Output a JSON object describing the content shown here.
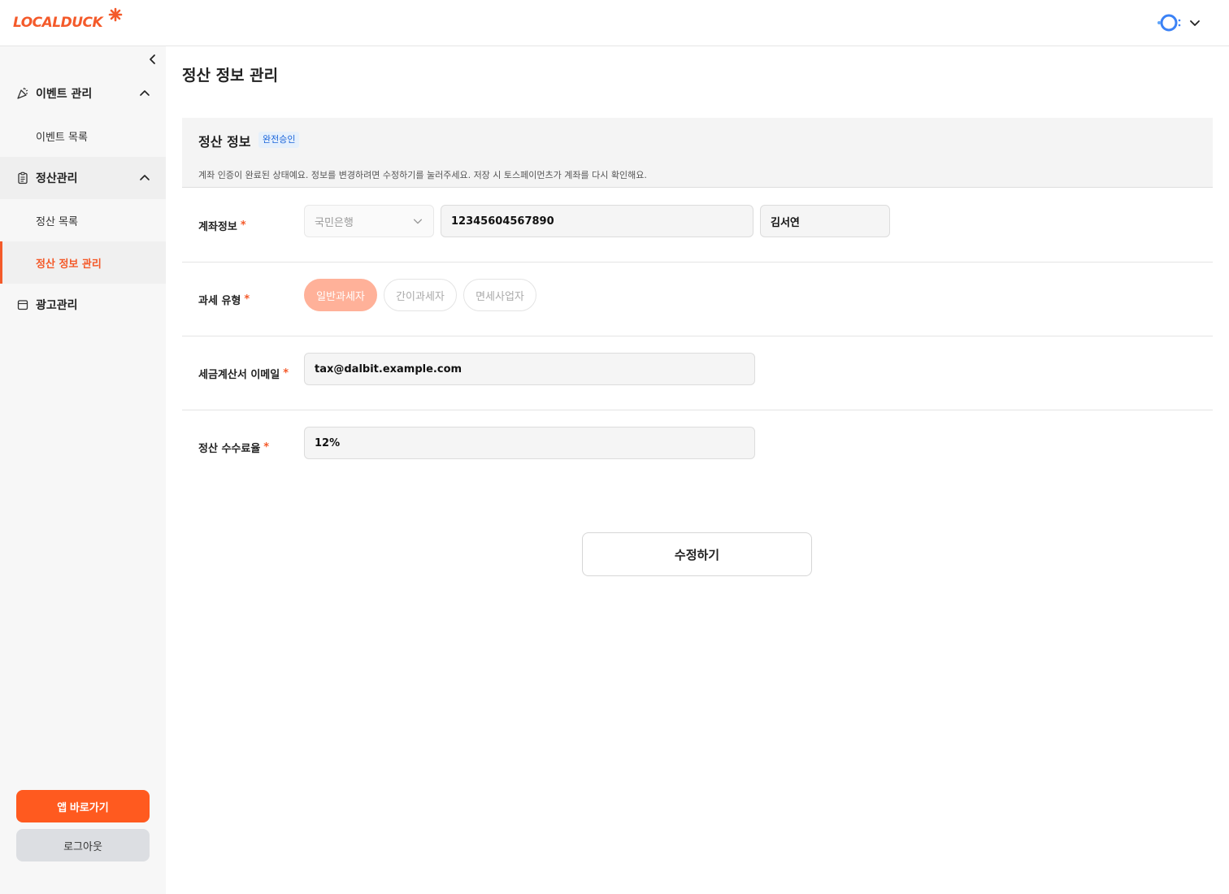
{
  "header": {
    "logo_text": "LOCALDUCK",
    "accent_color": "#f45a2a"
  },
  "sidebar": {
    "groups": [
      {
        "label": "이벤트 관리",
        "icon": "party-popper-icon",
        "expanded": true,
        "items": [
          {
            "label": "이벤트 목록",
            "active": false
          }
        ]
      },
      {
        "label": "정산관리",
        "icon": "clipboard-icon",
        "expanded": true,
        "items": [
          {
            "label": "정산 목록",
            "active": false
          },
          {
            "label": "정산 정보 관리",
            "active": true
          }
        ]
      },
      {
        "label": "광고관리",
        "icon": "calendar-icon",
        "expanded": false,
        "items": []
      }
    ],
    "app_button": "앱 바로가기",
    "logout_button": "로그아웃"
  },
  "main": {
    "page_title": "정산 정보 관리",
    "section": {
      "title": "정산 정보",
      "badge": "완전승인",
      "description": "계좌 인증이 완료된 상태예요. 정보를 변경하려면 수정하기를 눌러주세요. 저장 시 토스페이먼츠가 계좌를 다시 확인해요."
    },
    "form": {
      "account": {
        "label": "계좌정보",
        "required": "*",
        "bank": "국민은행",
        "account_number": "12345604567890",
        "holder": "김서연"
      },
      "tax_type": {
        "label": "과세 유형",
        "required": "*",
        "options": [
          "일반과세자",
          "간이과세자",
          "면세사업자"
        ],
        "selected": "일반과세자"
      },
      "tax_email": {
        "label": "세금계산서 이메일",
        "required": "*",
        "value": "tax@dalbit.example.com"
      },
      "commission": {
        "label": "정산 수수료율",
        "required": "*",
        "value": "12%"
      }
    },
    "edit_button": "수정하기"
  }
}
